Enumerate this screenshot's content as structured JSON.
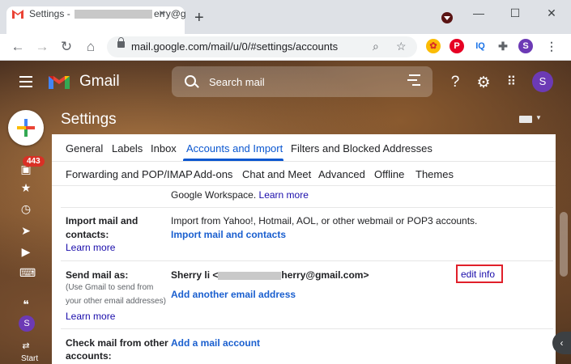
{
  "browser": {
    "tab_title_prefix": "Settings - ",
    "tab_title_suffix": "erry@g",
    "tab_close": "×",
    "new_tab": "+",
    "window_controls": [
      "—",
      "☐",
      "✕"
    ],
    "nav": {
      "back": "←",
      "forward": "→",
      "reload": "↻",
      "home": "⌂"
    },
    "url": "mail.google.com/mail/u/0/#settings/accounts",
    "extensions": [
      {
        "label": "P",
        "color": "#e60023",
        "icon": "pinterest-icon"
      },
      {
        "label": "IQ",
        "color": "#1a73e8",
        "icon": "iq-icon"
      },
      {
        "label": "S",
        "color": "#6c3ab5",
        "icon": "profile-avatar"
      }
    ]
  },
  "gmail": {
    "app_name": "Gmail",
    "search_placeholder": "Search mail",
    "avatar_letter": "S",
    "inbox_badge": "443",
    "rail_avatar": "S",
    "rail_start": "Start"
  },
  "settings": {
    "title": "Settings",
    "tabs_row1": [
      "General",
      "Labels",
      "Inbox",
      "Accounts and Import",
      "Filters and Blocked Addresses"
    ],
    "tabs_row2": [
      "Forwarding and POP/IMAP",
      "Add-ons",
      "Chat and Meet",
      "Advanced",
      "Offline",
      "Themes"
    ],
    "active_tab": "Accounts and Import",
    "workspace_text": "Google Workspace.",
    "workspace_link": "Learn more",
    "import": {
      "label_line1": "Import mail and",
      "label_line2": "contacts:",
      "learn_more": "Learn more",
      "description": "Import from Yahoo!, Hotmail, AOL, or other webmail or POP3 accounts.",
      "action": "Import mail and contacts"
    },
    "send_as": {
      "label": "Send mail as:",
      "help_line1": "(Use Gmail to send from",
      "help_line2": "your other email addresses)",
      "learn_more": "Learn more",
      "name_prefix": "Sherry li <",
      "email_suffix": "herry@gmail.com>",
      "edit": "edit info",
      "add_another": "Add another email address"
    },
    "check_mail": {
      "label_line1": "Check mail from other",
      "label_line2": "accounts:",
      "action": "Add a mail account"
    }
  }
}
